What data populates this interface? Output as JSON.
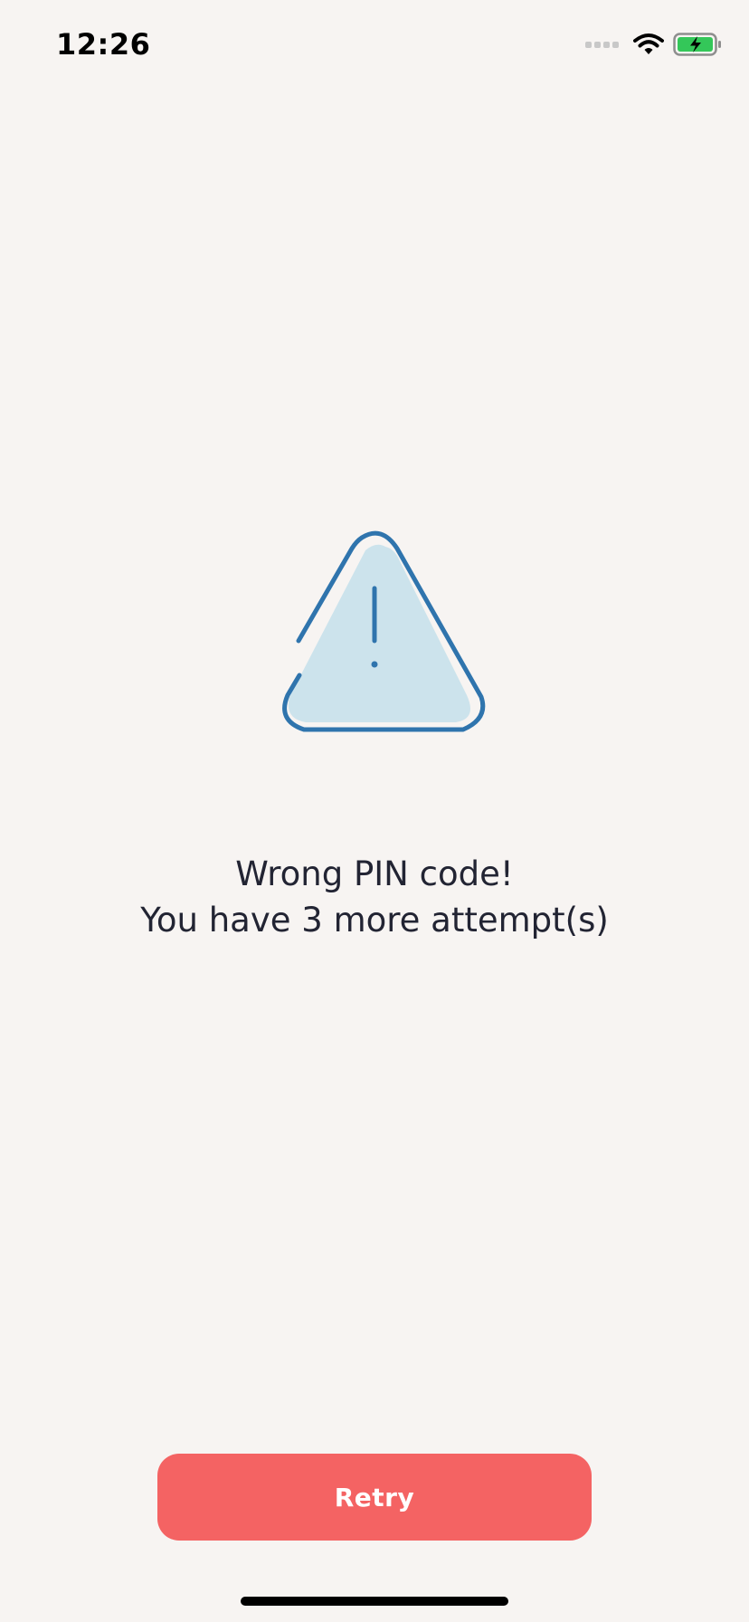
{
  "status_bar": {
    "time": "12:26",
    "signal_icon": "cellular-signal-icon",
    "wifi_icon": "wifi-icon",
    "battery_icon": "battery-charging-icon",
    "battery_color": "#34c759"
  },
  "alert": {
    "icon": "warning-triangle-icon",
    "icon_stroke_color": "#2f74ad",
    "icon_fill_color": "#cce3ec",
    "title": "Wrong PIN code!",
    "subtitle": "You have 3 more attempt(s)"
  },
  "actions": {
    "retry_label": "Retry",
    "retry_color": "#f46363"
  }
}
